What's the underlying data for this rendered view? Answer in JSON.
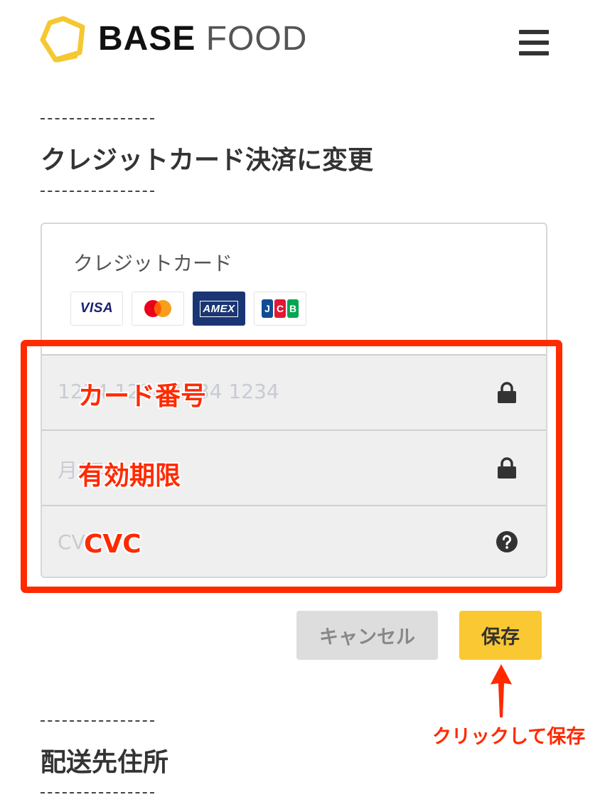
{
  "header": {
    "logo_bold": "BASE",
    "logo_light": "FOOD",
    "logo_color": "#f5c832",
    "menu_icon": "hamburger-menu-icon"
  },
  "credit_section": {
    "title": "クレジットカード決済に変更",
    "card_label": "クレジットカード",
    "brands": [
      "VISA",
      "Mastercard",
      "AMEX",
      "JCB"
    ],
    "fields": {
      "card_number_placeholder": "1234 1234 1234 1234",
      "expiry_placeholder": "月/年",
      "cvc_placeholder": "CVC",
      "card_number_icon": "lock-icon",
      "expiry_icon": "lock-icon",
      "cvc_icon": "question-circle-icon"
    }
  },
  "annotations": {
    "card_number": "カード番号",
    "expiry": "有効期限",
    "cvc": "CVC",
    "click_save": "クリックして保存",
    "color": "#ff2a00"
  },
  "buttons": {
    "cancel": "キャンセル",
    "save": "保存",
    "save_color": "#fac832",
    "cancel_color": "#dddddd"
  },
  "address_section": {
    "title": "配送先住所"
  }
}
